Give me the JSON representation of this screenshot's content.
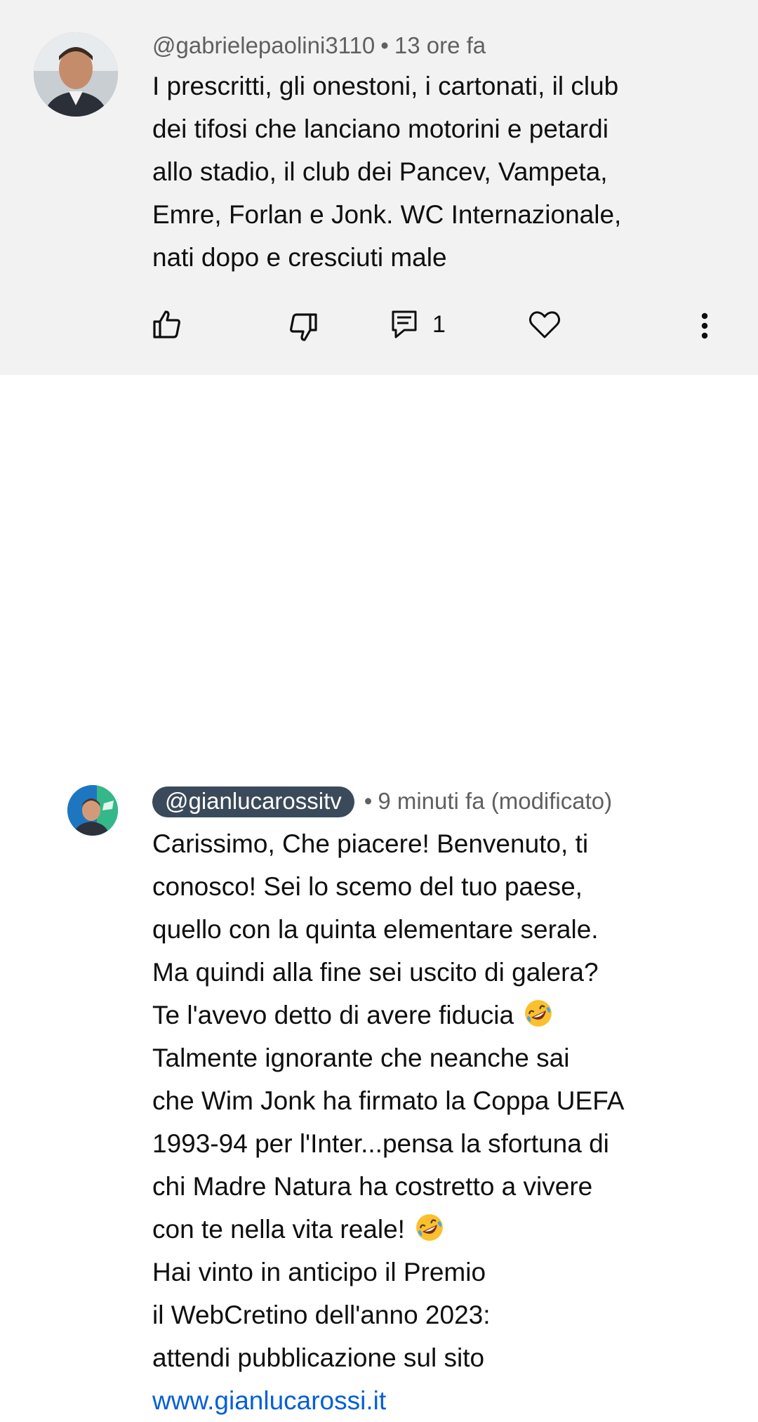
{
  "comments": [
    {
      "author": "@gabrielepaolini3110",
      "time": "13 ore fa",
      "lines": [
        "I prescritti, gli onestoni, i cartonati, il club",
        "dei tifosi che lanciano motorini e petardi",
        "allo stadio, il club dei Pancev, Vampeta,",
        "Emre, Forlan e Jonk. WC Internazionale,",
        "nati dopo e cresciuti male"
      ],
      "reply_count": "1",
      "icons": [
        "thumb-up-icon",
        "thumb-down-icon",
        "reply-icon",
        "heart-icon",
        "more-vert-icon"
      ]
    },
    {
      "author": "@gianlucarossitv",
      "time": "9 minuti fa (modificato)",
      "lines": [
        "Carissimo, Che piacere! Benvenuto, ti",
        "conosco! Sei lo scemo del tuo paese,",
        "quello con la quinta elementare serale.",
        "Ma quindi alla fine sei uscito di galera?",
        "Te l'avevo detto di avere fiducia",
        "Talmente ignorante che neanche sai",
        "che Wim Jonk ha firmato la Coppa UEFA",
        "1993-94 per l'Inter...pensa la sfortuna di",
        "chi Madre Natura ha costretto a vivere",
        "con te nella vita reale!",
        "Hai vinto in anticipo il Premio",
        "il WebCretino dell'anno 2023:",
        "attendi pubblicazione sul sito"
      ],
      "link": "www.gianlucarossi.it",
      "emoji": "rolling-on-floor-laughing-emoji"
    }
  ],
  "separator": "•",
  "colors": {
    "top_background": "#f2f2f2",
    "meta_text": "#606060",
    "handle_pill": "#3b4a5a",
    "link": "#065fd4"
  }
}
